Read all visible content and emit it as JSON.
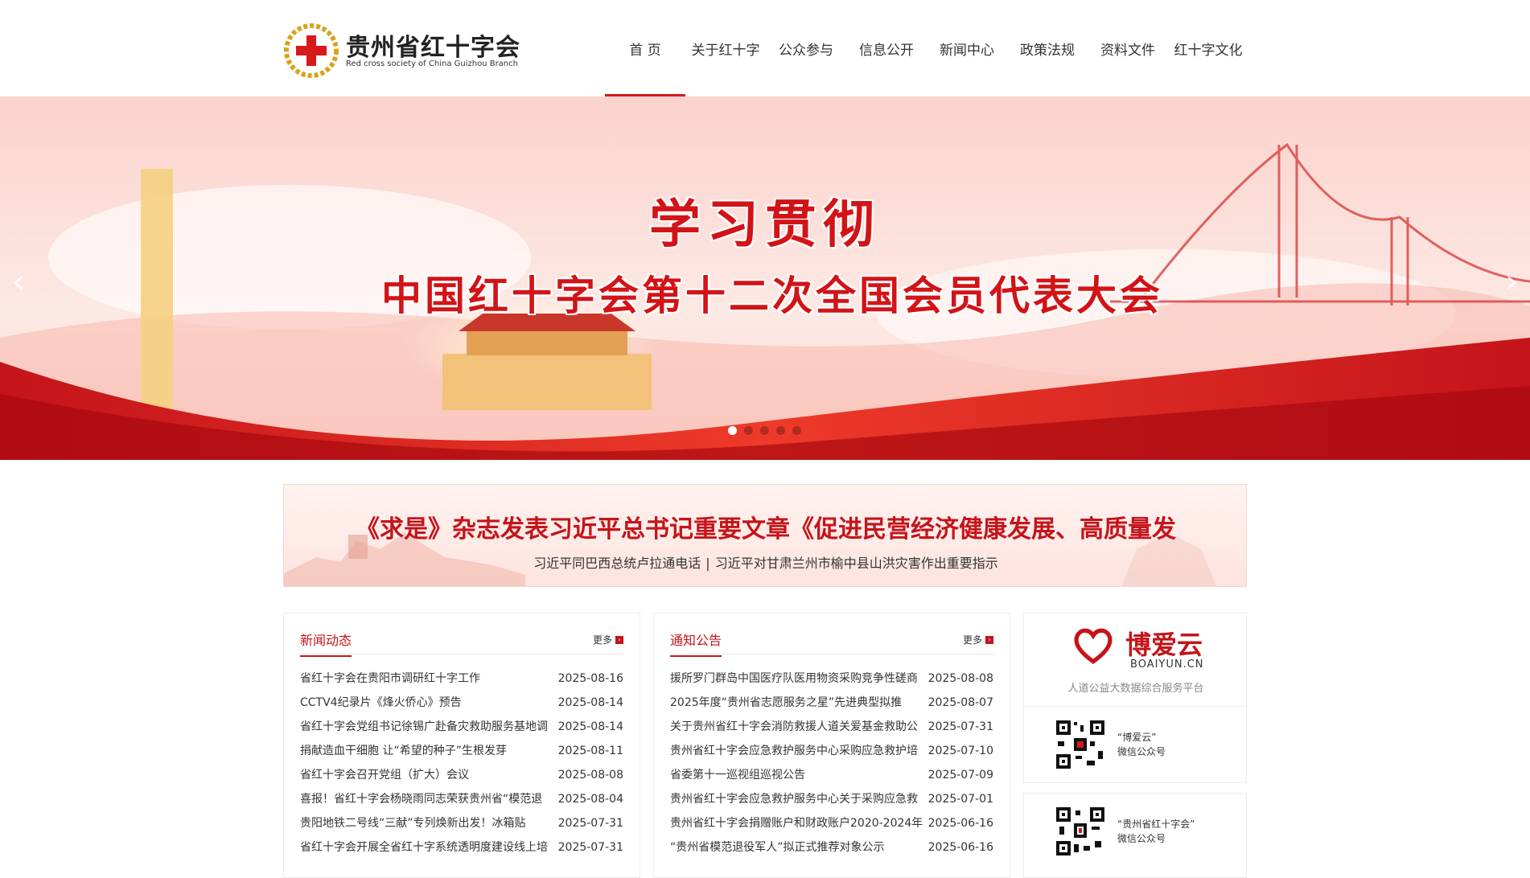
{
  "header": {
    "logo_title": "贵州省红十字会",
    "logo_subtitle": "Red cross society of China Guizhou Branch",
    "nav": [
      {
        "label": "首 页",
        "active": true
      },
      {
        "label": "关于红十字",
        "active": false
      },
      {
        "label": "公众参与",
        "active": false
      },
      {
        "label": "信息公开",
        "active": false
      },
      {
        "label": "新闻中心",
        "active": false
      },
      {
        "label": "政策法规",
        "active": false
      },
      {
        "label": "资料文件",
        "active": false
      },
      {
        "label": "红十字文化",
        "active": false
      }
    ]
  },
  "banner": {
    "title1": "学习贯彻",
    "title2": "中国红十字会第十二次全国会员代表大会",
    "slide_count": 5,
    "active_slide": 1
  },
  "headline": {
    "title": "《求是》杂志发表习近平总书记重要文章《促进民营经济健康发展、高质量发",
    "links": [
      "习近平同巴西总统卢拉通电话",
      "习近平对甘肃兰州市榆中县山洪灾害作出重要指示"
    ],
    "separator": "|"
  },
  "news": {
    "title": "新闻动态",
    "more": "更多",
    "items": [
      {
        "title": "省红十字会在贵阳市调研红十字工作",
        "date": "2025-08-16"
      },
      {
        "title": "CCTV4纪录片《烽火侨心》预告",
        "date": "2025-08-14"
      },
      {
        "title": "省红十字会党组书记徐锡广赴备灾救助服务基地调",
        "date": "2025-08-14"
      },
      {
        "title": "捐献造血干细胞 让“希望的种子”生根发芽",
        "date": "2025-08-11"
      },
      {
        "title": "省红十字会召开党组（扩大）会议",
        "date": "2025-08-08"
      },
      {
        "title": "喜报！省红十字会杨晓雨同志荣获贵州省“模范退",
        "date": "2025-08-04"
      },
      {
        "title": "贵阳地铁二号线“三献”专列焕新出发！冰箱贴",
        "date": "2025-07-31"
      },
      {
        "title": "省红十字会开展全省红十字系统透明度建设线上培",
        "date": "2025-07-31"
      }
    ]
  },
  "notices": {
    "title": "通知公告",
    "more": "更多",
    "items": [
      {
        "title": "援所罗门群岛中国医疗队医用物资采购竞争性磋商",
        "date": "2025-08-08"
      },
      {
        "title": "2025年度“贵州省志愿服务之星”先进典型拟推",
        "date": "2025-08-07"
      },
      {
        "title": "关于贵州省红十字会消防救援人道关爱基金救助公",
        "date": "2025-07-31"
      },
      {
        "title": "贵州省红十字会应急救护服务中心采购应急救护培",
        "date": "2025-07-10"
      },
      {
        "title": "省委第十一巡视组巡视公告",
        "date": "2025-07-09"
      },
      {
        "title": "贵州省红十字会应急救护服务中心关于采购应急救",
        "date": "2025-07-01"
      },
      {
        "title": "贵州省红十字会捐赠账户和财政账户2020-2024年",
        "date": "2025-06-16"
      },
      {
        "title": "“贵州省模范退役军人”拟正式推荐对象公示",
        "date": "2025-06-16"
      }
    ]
  },
  "sidebar": {
    "boai_name": "博爱云",
    "boai_domain": "BOAIYUN.CN",
    "boai_tagline": "人道公益大数据综合服务平台",
    "qr1_line1": "“博爱云”",
    "qr1_line2": "微信公众号",
    "qr2_line1": "“贵州省红十字会”",
    "qr2_line2": "微信公众号"
  },
  "colors": {
    "brand_red": "#c4141a",
    "nav_active": "#d7191b"
  }
}
